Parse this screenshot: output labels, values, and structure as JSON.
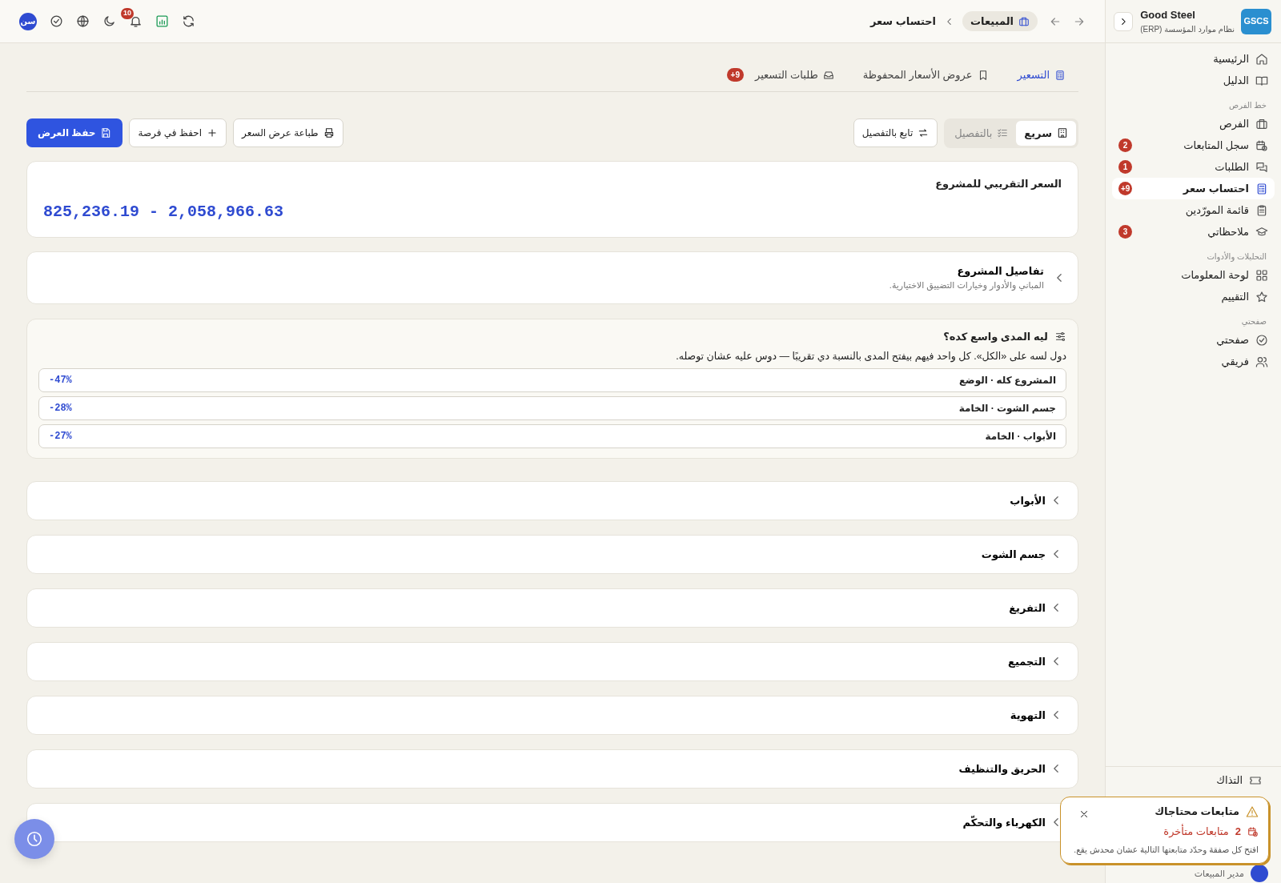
{
  "brand": {
    "logo": "GSCS",
    "name": "Good Steel",
    "subtitle": "نظام موارد المؤسسة (ERP)"
  },
  "sidebar": {
    "groups": [
      {
        "items": [
          {
            "label": "الرئيسية",
            "selected": false
          },
          {
            "label": "الدليل",
            "selected": false
          }
        ]
      },
      {
        "heading": "خط الفرص",
        "items": [
          {
            "label": "الفرص",
            "selected": false
          },
          {
            "label": "سجل المتابعات",
            "badge": "2",
            "selected": false
          },
          {
            "label": "الطلبات",
            "badge": "1",
            "selected": false
          },
          {
            "label": "احتساب سعر",
            "badge": "+9",
            "selected": true
          },
          {
            "label": "قائمة المورّدين",
            "selected": false
          },
          {
            "label": "ملاحظاتي",
            "badge": "3",
            "selected": false
          }
        ]
      },
      {
        "heading": "التحليلات والأدوات",
        "items": [
          {
            "label": "لوحة المعلومات",
            "selected": false
          },
          {
            "label": "التقييم",
            "selected": false
          }
        ]
      },
      {
        "heading": "صفحتي",
        "items": [
          {
            "label": "صفحتي",
            "selected": false
          },
          {
            "label": "فريقي",
            "selected": false
          }
        ]
      }
    ],
    "footer_item": "التذاك",
    "user_role": "مدير المبيعات"
  },
  "topbar": {
    "breadcrumb": [
      {
        "label": "المبيعات"
      },
      {
        "label": "احتساب سعر"
      }
    ],
    "notifications": "10",
    "avatar": "سن"
  },
  "tabs": [
    {
      "label": "التسعير",
      "selected": true
    },
    {
      "label": "عروض الأسعار المحفوظة",
      "selected": false
    },
    {
      "label": "طلبات التسعير",
      "badge": "+9",
      "selected": false
    }
  ],
  "modes": [
    {
      "label": "سريع",
      "selected": true
    },
    {
      "label": "بالتفصيل",
      "selected": false
    }
  ],
  "follow_button": "تابع بالتفصيل",
  "actions": [
    {
      "label": "طباعة عرض السعر",
      "primary": false
    },
    {
      "label": "احفظ في فرصة",
      "primary": false
    },
    {
      "label": "حفظ العرض",
      "primary": true
    }
  ],
  "price": {
    "title": "السعر التقريبي للمشروع",
    "range": "825,236.19 - 2,058,966.63"
  },
  "details": {
    "title": "تفاصيل المشروع",
    "subtitle": "المباني والأدوار وخيارات التضييق الاختيارية.",
    "expanded": false
  },
  "why": {
    "title": "ليه المدى واسع كده؟",
    "description": "دول لسه على «الكل». كل واحد فيهم بيفتح المدى بالنسبة دي تقريبًا — دوس عليه عشان توصله.",
    "rows": [
      {
        "label": "المشروع كله · الوضع",
        "value": "-47%"
      },
      {
        "label": "جسم الشوت · الخامة",
        "value": "-28%"
      },
      {
        "label": "الأبواب · الخامة",
        "value": "-27%"
      }
    ]
  },
  "sections": [
    {
      "title": "الأبواب",
      "expanded": false
    },
    {
      "title": "جسم الشوت",
      "expanded": false
    },
    {
      "title": "التفريغ",
      "expanded": false
    },
    {
      "title": "التجميع",
      "expanded": false
    },
    {
      "title": "التهوية",
      "expanded": false
    },
    {
      "title": "الحريق والتنظيف",
      "expanded": false
    },
    {
      "title": "الكهرباء والتحكّم",
      "expanded": false
    }
  ],
  "toast": {
    "title": "متابعات محتاجاك",
    "count": "2",
    "count_label": "متابعات متأخرة",
    "message": "افتح كل صفقة وحدّد متابعتها التالية عشان محدش يقع."
  }
}
